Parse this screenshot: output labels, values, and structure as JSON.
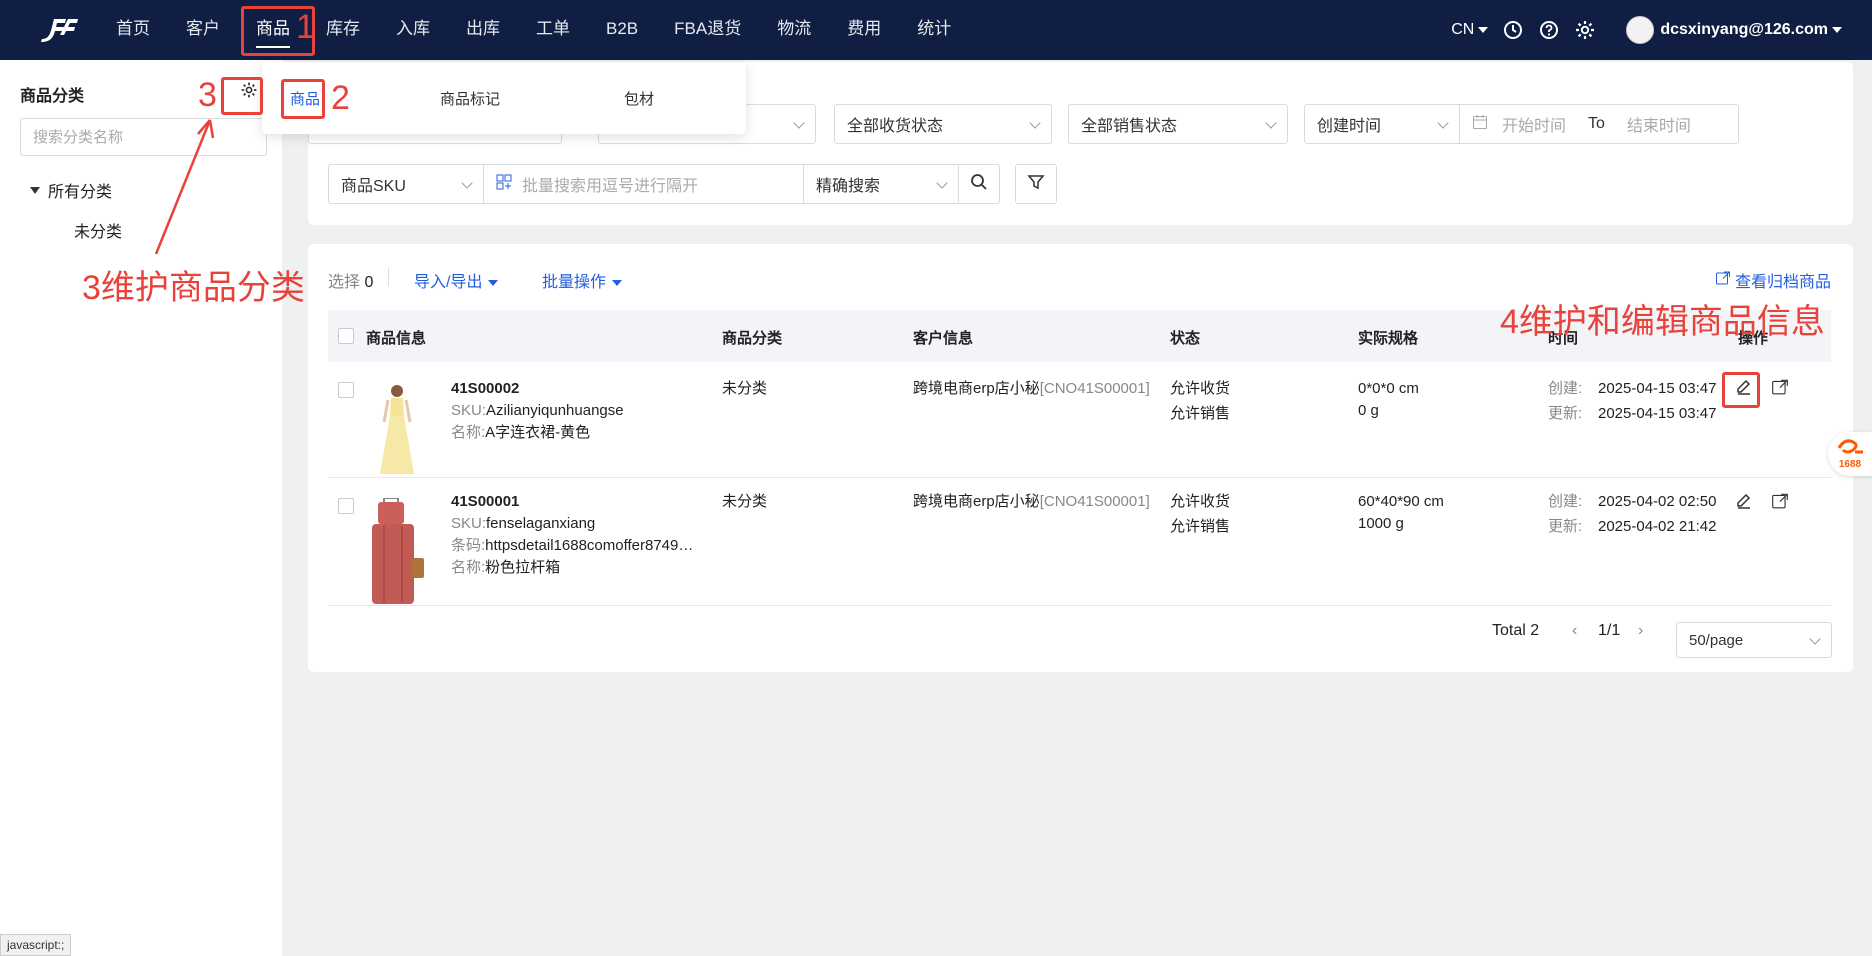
{
  "nav": [
    "首页",
    "客户",
    "商品",
    "库存",
    "入库",
    "出库",
    "工单",
    "B2B",
    "FBA退货",
    "物流",
    "费用",
    "统计"
  ],
  "header": {
    "lang": "CN",
    "user": "dcsxinyang@126.com"
  },
  "sidebar": {
    "title": "商品分类",
    "search_placeholder": "搜索分类名称",
    "root": "所有分类",
    "child": "未分类"
  },
  "dropdown": [
    "商品",
    "商品标记",
    "包材"
  ],
  "filters": {
    "receive": "全部收货状态",
    "sale": "全部销售状态",
    "time_type": "创建时间",
    "start_placeholder": "开始时间",
    "to": "To",
    "end_placeholder": "结束时间",
    "sku_type": "商品SKU",
    "batch_placeholder": "批量搜索用逗号进行隔开",
    "match": "精确搜索"
  },
  "toolbar": {
    "selected_label": "选择",
    "selected_count": "0",
    "import_export": "导入/导出",
    "batch": "批量操作",
    "archived": "查看归档商品"
  },
  "columns": [
    "商品信息",
    "商品分类",
    "客户信息",
    "状态",
    "实际规格",
    "时间",
    "操作"
  ],
  "rows": [
    {
      "code": "41S00002",
      "sku_label": "SKU:",
      "sku": "Azilianyiqunhuangse",
      "name_label": "名称:",
      "name": "A字连衣裙-黄色",
      "category": "未分类",
      "customer": "跨境电商erp店小秘",
      "customer_code": "[CNO41S00001]",
      "status1": "允许收货",
      "status2": "允许销售",
      "size": "0*0*0 cm",
      "weight": "0 g",
      "created_label": "创建:",
      "created": "2025-04-15 03:47",
      "updated_label": "更新:",
      "updated": "2025-04-15 03:47"
    },
    {
      "code": "41S00001",
      "sku_label": "SKU:",
      "sku": "fenselaganxiang",
      "barcode_label": "条码:",
      "barcode": "httpsdetail1688comoffer8749…",
      "name_label": "名称:",
      "name": "粉色拉杆箱",
      "category": "未分类",
      "customer": "跨境电商erp店小秘",
      "customer_code": "[CNO41S00001]",
      "status1": "允许收货",
      "status2": "允许销售",
      "size": "60*40*90 cm",
      "weight": "1000 g",
      "created_label": "创建:",
      "created": "2025-04-02 02:50",
      "updated_label": "更新:",
      "updated": "2025-04-02 21:42"
    }
  ],
  "pagination": {
    "total": "Total 2",
    "page": "1/1",
    "page_size": "50/page"
  },
  "annotations": {
    "a1": "1",
    "a2": "2",
    "a3": "3",
    "a3_text": "3维护商品分类",
    "a4_text": "4维护和编辑商品信息"
  },
  "badge": "1688",
  "statusbar": "javascript:;",
  "colors": {
    "topbar": "#0f1e42",
    "accent": "#1f5fe0",
    "annotation": "#e8423a"
  }
}
